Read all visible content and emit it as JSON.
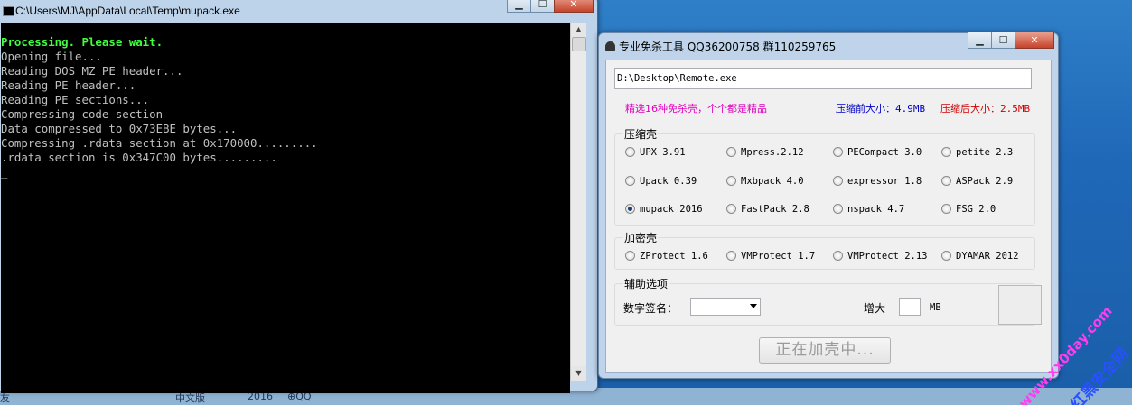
{
  "console": {
    "title": "C:\\Users\\MJ\\AppData\\Local\\Temp\\mupack.exe",
    "lines": [
      {
        "text": "Processing. Please wait.",
        "color": "green"
      },
      {
        "text": "Opening file...",
        "color": "gray"
      },
      {
        "text": "Reading DOS MZ PE header...",
        "color": "gray"
      },
      {
        "text": "Reading PE header...",
        "color": "gray"
      },
      {
        "text": "Reading PE sections...",
        "color": "gray"
      },
      {
        "text": "Compressing code section",
        "color": "gray"
      },
      {
        "text": "Data compressed to 0x73EBE bytes...",
        "color": "gray"
      },
      {
        "text": "Compressing .rdata section at 0x170000.........",
        "color": "gray"
      },
      {
        "text": ".rdata section is 0x347C00 bytes.........",
        "color": "gray"
      },
      {
        "text": "_",
        "color": "gray"
      }
    ]
  },
  "tool": {
    "title": "专业免杀工具 QQ36200758 群110259765",
    "path": "D:\\Desktop\\Remote.exe",
    "promo": "精选16种免杀壳，个个都是精品",
    "before_label": "压缩前大小：",
    "before_value": "4.9MB",
    "after_label": "压缩后大小：",
    "after_value": "2.5MB",
    "compress_group": "压缩壳",
    "compress_options": [
      {
        "label": "UPX 3.91",
        "selected": false
      },
      {
        "label": "Mpress.2.12",
        "selected": false
      },
      {
        "label": "PECompact 3.0",
        "selected": false
      },
      {
        "label": "petite 2.3",
        "selected": false
      },
      {
        "label": "Upack 0.39",
        "selected": false
      },
      {
        "label": "Mxbpack 4.0",
        "selected": false
      },
      {
        "label": "expressor 1.8",
        "selected": false
      },
      {
        "label": "ASPack 2.9",
        "selected": false
      },
      {
        "label": "mupack 2016",
        "selected": true
      },
      {
        "label": "FastPack 2.8",
        "selected": false
      },
      {
        "label": "nspack 4.7",
        "selected": false
      },
      {
        "label": "FSG 2.0",
        "selected": false
      }
    ],
    "encrypt_group": "加密壳",
    "encrypt_options": [
      {
        "label": "ZProtect 1.6",
        "selected": false
      },
      {
        "label": "VMProtect 1.7",
        "selected": false
      },
      {
        "label": "VMProtect 2.13",
        "selected": false
      },
      {
        "label": "DYAMAR 2012",
        "selected": false
      }
    ],
    "aux_group": "辅助选项",
    "signature_label": "数字签名：",
    "enlarge_label": "增大",
    "enlarge_unit": "MB",
    "action_button": "正在加壳中..."
  },
  "taskbar": {
    "items": [
      "友",
      "中文版",
      "2016",
      "⊕QQ"
    ]
  },
  "watermark": {
    "line1": "www.xx0day.com",
    "line2": "红黑安全网"
  },
  "colors": {
    "console_green": "#3fff3f",
    "promo_magenta": "#e000c0",
    "before_blue": "#0000c8",
    "after_red": "#d00000"
  }
}
